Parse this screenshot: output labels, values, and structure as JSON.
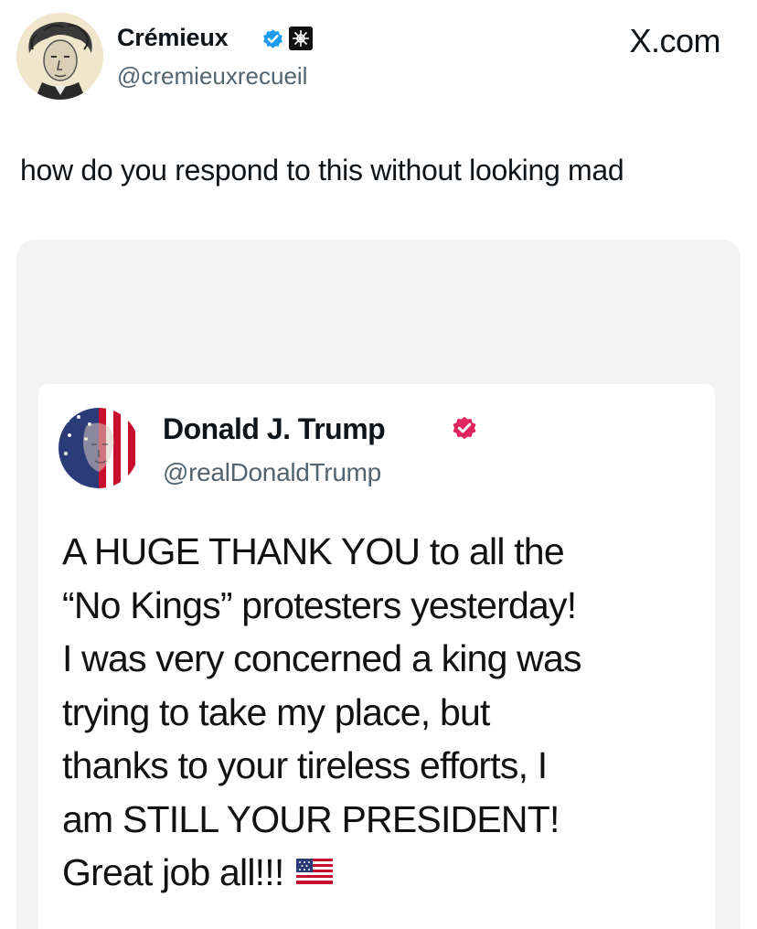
{
  "author": {
    "display_name": "Crémieux",
    "handle": "@cremieuxrecueil",
    "avatar_icon": "engraved-portrait-avatar",
    "verified_icon": "verified-badge-icon",
    "affiliation_icon": "affiliation-badge-icon"
  },
  "watermark": {
    "label": "X.com"
  },
  "tweet": {
    "text": "how do you respond to this without looking mad"
  },
  "quoted_post": {
    "display_name": "Donald J. Trump",
    "handle": "@realDonaldTrump",
    "avatar_icon": "flag-portrait-avatar",
    "badge_icon": "verified-badge-icon",
    "badge_color": "#e0245e",
    "lines": [
      "A HUGE THANK YOU to all the",
      "“No Kings” protesters yesterday!",
      "I was very concerned a king was",
      "trying to take my place, but",
      "thanks to your tireless efforts, I",
      "am STILL YOUR PRESIDENT!",
      "Great job all!!!"
    ],
    "trailing_emoji": "us-flag-emoji"
  },
  "colors": {
    "verified_blue": "#1d9bf0",
    "secondary_text": "#536471",
    "card_background": "#f3f3f3"
  }
}
